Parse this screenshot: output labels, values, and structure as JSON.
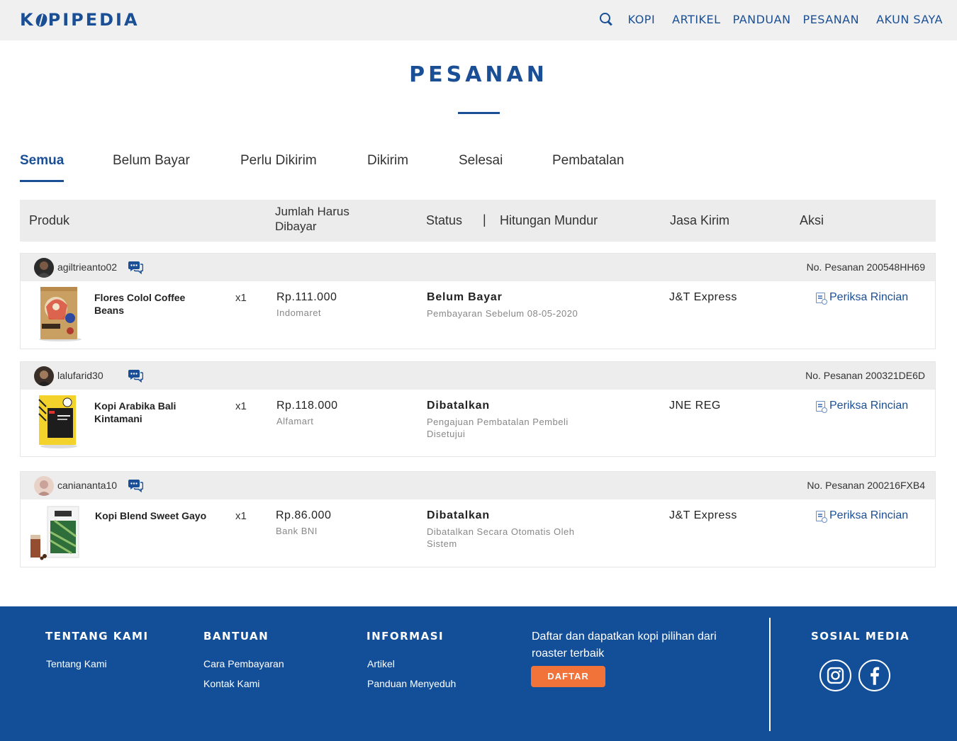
{
  "header": {
    "logo_pre": "K",
    "logo_post": "PIPEDIA",
    "nav": [
      "KOPI",
      "ARTIKEL",
      "PANDUAN",
      "PESANAN",
      "AKUN SAYA"
    ]
  },
  "page_title": "PESANAN",
  "tabs": [
    "Semua",
    "Belum Bayar",
    "Perlu Dikirim",
    "Dikirim",
    "Selesai",
    "Pembatalan"
  ],
  "active_tab": "Semua",
  "table_header": {
    "produk": "Produk",
    "jumlah_1": "Jumlah Harus",
    "jumlah_2": "Dibayar",
    "status": "Status",
    "separator": "|",
    "countdown": "Hitungan Mundur",
    "courier": "Jasa Kirim",
    "action": "Aksi"
  },
  "orders": [
    {
      "username": "agiltrieanto02",
      "order_no": "No. Pesanan 200548HH69",
      "product": "Flores Colol Coffee Beans",
      "qty": "x1",
      "price": "Rp.111.000",
      "payment": "Indomaret",
      "status": "Belum Bayar",
      "status_note": "Pembayaran Sebelum 08-05-2020",
      "courier": "J&T Express",
      "action": "Periksa Rincian"
    },
    {
      "username": "lalufarid30",
      "order_no": "No. Pesanan 200321DE6D",
      "product": "Kopi Arabika Bali Kintamani",
      "qty": "x1",
      "price": "Rp.118.000",
      "payment": "Alfamart",
      "status": "Dibatalkan",
      "status_note": "Pengajuan Pembatalan Pembeli Disetujui",
      "courier": "JNE REG",
      "action": "Periksa Rincian"
    },
    {
      "username": "caniananta10",
      "order_no": "No. Pesanan 200216FXB4",
      "product": "Kopi Blend Sweet Gayo",
      "qty": "x1",
      "price": "Rp.86.000",
      "payment": "Bank BNI",
      "status": "Dibatalkan",
      "status_note": "Dibatalkan Secara Otomatis Oleh Sistem",
      "courier": "J&T Express",
      "action": "Periksa Rincian"
    }
  ],
  "footer": {
    "about_heading": "TENTANG KAMI",
    "about_links": [
      "Tentang Kami"
    ],
    "help_heading": "BANTUAN",
    "help_links": [
      "Cara Pembayaran",
      "Kontak Kami"
    ],
    "info_heading": "INFORMASI",
    "info_links": [
      "Artikel",
      "Panduan Menyeduh"
    ],
    "promo_text": "Daftar dan dapatkan kopi pilihan dari roaster terbaik",
    "register_button": "DAFTAR",
    "social_heading": "SOSIAL MEDIA",
    "social_icons": [
      "instagram-icon",
      "facebook-icon"
    ]
  },
  "colors": {
    "brand_blue": "#1a4f96",
    "footer_blue": "#134f98",
    "cta_orange": "#f2733a"
  }
}
